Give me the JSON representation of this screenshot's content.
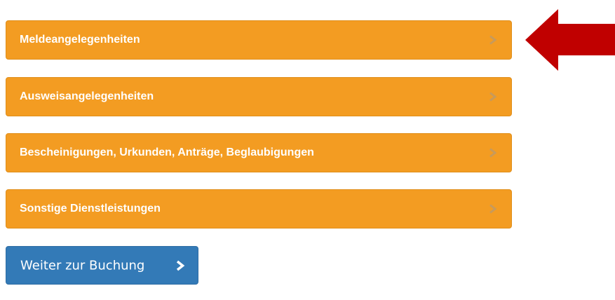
{
  "accordion": {
    "items": [
      {
        "label": "Meldeangelegenheiten",
        "icon": "chevron-right-icon"
      },
      {
        "label": "Ausweisangelegenheiten",
        "icon": "chevron-right-icon"
      },
      {
        "label": "Bescheinigungen, Urkunden, Anträge, Beglaubigungen",
        "icon": "chevron-right-icon"
      },
      {
        "label": "Sonstige Dienstleistungen",
        "icon": "chevron-right-icon"
      }
    ]
  },
  "booking": {
    "button_label": "Weiter zur Buchung",
    "icon": "chevron-right-icon"
  },
  "annotation": {
    "icon": "arrow-left-icon"
  },
  "colors": {
    "accordion_bg": "#f39c22",
    "chevron_muted": "#c89a5a",
    "primary_button": "#337ab7",
    "annotation_arrow": "#c00000",
    "text_on_color": "#ffffff"
  }
}
